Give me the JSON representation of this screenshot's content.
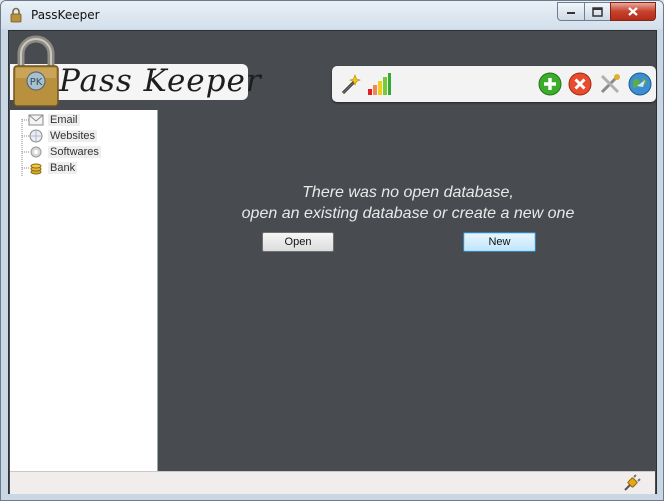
{
  "window": {
    "title": "PassKeeper",
    "controls": [
      "minimize",
      "maximize",
      "close"
    ]
  },
  "header": {
    "app_name": "Pass Keeper",
    "logo_icon": "padlock-icon"
  },
  "toolbar": {
    "left_icons": [
      "magic-wand-icon",
      "signal-bars-icon"
    ],
    "right_icons": [
      "add-icon",
      "delete-icon",
      "settings-icon",
      "globe-icon"
    ]
  },
  "tree": {
    "items": [
      {
        "label": "Email",
        "icon": "email-icon"
      },
      {
        "label": "Websites",
        "icon": "websites-icon"
      },
      {
        "label": "Softwares",
        "icon": "softwares-icon"
      },
      {
        "label": "Bank",
        "icon": "bank-icon"
      }
    ]
  },
  "main": {
    "message_line1": "There was no open database,",
    "message_line2": "open an existing database or create a new one",
    "open_label": "Open",
    "new_label": "New"
  },
  "status": {
    "connection_icon": "plug-icon"
  }
}
